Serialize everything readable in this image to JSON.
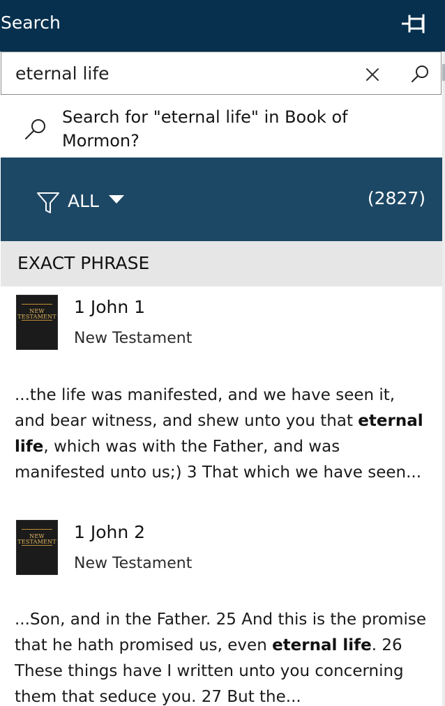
{
  "window": {
    "title": "Search",
    "pin_icon": "pin-icon"
  },
  "search": {
    "value": "eternal life",
    "placeholder": "",
    "clear_icon": "close-icon",
    "submit_icon": "search-icon"
  },
  "suggestion": {
    "icon": "search-icon",
    "line_1": "Search for \"eternal life\" in Book of",
    "line_2": "Mormon?"
  },
  "filter": {
    "icon": "filter-icon",
    "label": "ALL",
    "caret_icon": "triangle-down-icon",
    "result_count": "(2827)"
  },
  "section": {
    "title": "EXACT PHRASE"
  },
  "results": [
    {
      "title": "1 John 1",
      "subtitle": "New Testament",
      "book_image": {
        "label_line_1": "NEW",
        "label_line_2": "TESTAMENT"
      },
      "excerpt": {
        "before": "...the life was manifested, and we have seen it, and bear witness, and shew unto you that ",
        "highlight": "eternal life",
        "after": ", which was with the Father, and was manifested unto us;) 3 That which we have seen..."
      }
    },
    {
      "title": "1 John 2",
      "subtitle": "New Testament",
      "book_image": {
        "label_line_1": "NEW",
        "label_line_2": "TESTAMENT"
      },
      "excerpt": {
        "before": "...Son, and in the Father. 25 And this is the promise that he hath promised us, even ",
        "highlight": "eternal life",
        "after": ". 26 These things have I written unto you concerning them that seduce you. 27 But the..."
      }
    }
  ],
  "colors": {
    "title_bar": "#06304d",
    "filter_bar": "#1d4865",
    "section_header": "#e6e6e6",
    "book_cover": "#1b1b1b",
    "book_label": "#e3b85f"
  }
}
